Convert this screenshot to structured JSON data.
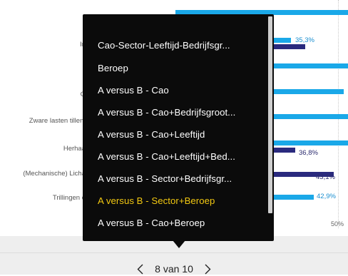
{
  "chart": {
    "rows": [
      {
        "label": "In",
        "value_label": "35,3%"
      },
      {
        "label": "G",
        "value_label": ""
      },
      {
        "label": "Zware lasten tillen,",
        "value_label": ""
      },
      {
        "label": "Herhaa",
        "value_label": "36,8%"
      },
      {
        "label": "(Mechanische) Licha",
        "value_label": "43,1%"
      },
      {
        "label": "Trillingen o",
        "value_label": "42,9%"
      }
    ],
    "axis_tick": "50%",
    "colors": {
      "series_light": "#1aa8e8",
      "series_dark": "#2a2a7e"
    }
  },
  "dropdown": {
    "items": [
      "Cao-Sector-Leeftijd-Bedrijfsgr...",
      "Beroep",
      "A versus B - Cao",
      "A versus B - Cao+Bedrijfsgroot...",
      "A versus B - Cao+Leeftijd",
      "A versus B - Cao+Leeftijd+Bed...",
      "A versus B - Sector+Bedrijfsgr...",
      "A versus B - Sector+Beroep",
      "A versus B - Cao+Beroep"
    ],
    "selected_index": 7,
    "selected_color": "#f2c811"
  },
  "pager": {
    "prev_icon": "chevron-left-icon",
    "next_icon": "chevron-right-icon",
    "text": "8 van 10"
  }
}
